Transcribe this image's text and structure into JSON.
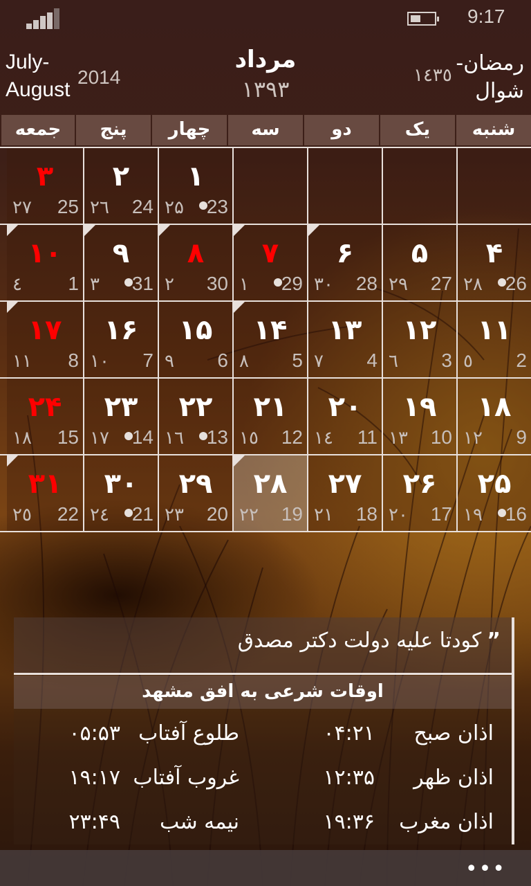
{
  "status_bar": {
    "signal_icon": "signal-strength-icon",
    "battery_icon": "battery-icon",
    "battery_level_percent": 35,
    "time": "9:17"
  },
  "header": {
    "gregorian_month": "July-\nAugust",
    "gregorian_month_line1": "July-",
    "gregorian_month_line2": "August",
    "gregorian_year": "2014",
    "persian_month": "مرداد",
    "persian_year": "۱۳۹۳",
    "hijri_month_line1": "رمضان-",
    "hijri_month_line2": "شوال",
    "hijri_year": "۱٤۳٥"
  },
  "weekdays": [
    "شنبه",
    "یک",
    "دو",
    "سه",
    "چهار",
    "پنج",
    "جمعه"
  ],
  "calendar": {
    "colors": {
      "holiday": "#ff0000",
      "normal": "#ffffff",
      "secondary": "#c8c0bc"
    },
    "rows": [
      [
        {
          "empty": true
        },
        {
          "empty": true
        },
        {
          "empty": true
        },
        {
          "empty": true
        },
        {
          "persian": "۱",
          "greg": "23",
          "hijri": "۲۵",
          "dot": true
        },
        {
          "persian": "۲",
          "greg": "24",
          "hijri": "۲٦"
        },
        {
          "persian": "۳",
          "greg": "25",
          "hijri": "۲۷",
          "holiday": true
        }
      ],
      [
        {
          "persian": "۴",
          "greg": "26",
          "hijri": "۲۸",
          "dot": true
        },
        {
          "persian": "۵",
          "greg": "27",
          "hijri": "۲۹"
        },
        {
          "persian": "۶",
          "greg": "28",
          "hijri": "۳۰",
          "corner": true
        },
        {
          "persian": "۷",
          "greg": "29",
          "hijri": "۱",
          "dot": true,
          "holiday": true,
          "corner": true
        },
        {
          "persian": "۸",
          "greg": "30",
          "hijri": "۲",
          "holiday": true,
          "corner": true
        },
        {
          "persian": "۹",
          "greg": "31",
          "hijri": "۳",
          "dot": true,
          "corner": true
        },
        {
          "persian": "۱۰",
          "greg": "1",
          "hijri": "٤",
          "holiday": true,
          "corner": true
        }
      ],
      [
        {
          "persian": "۱۱",
          "greg": "2",
          "hijri": "٥"
        },
        {
          "persian": "۱۲",
          "greg": "3",
          "hijri": "٦"
        },
        {
          "persian": "۱۳",
          "greg": "4",
          "hijri": "۷"
        },
        {
          "persian": "۱۴",
          "greg": "5",
          "hijri": "۸",
          "corner": true
        },
        {
          "persian": "۱۵",
          "greg": "6",
          "hijri": "۹"
        },
        {
          "persian": "۱۶",
          "greg": "7",
          "hijri": "۱۰"
        },
        {
          "persian": "۱۷",
          "greg": "8",
          "hijri": "۱۱",
          "holiday": true,
          "corner": true
        }
      ],
      [
        {
          "persian": "۱۸",
          "greg": "9",
          "hijri": "۱۲"
        },
        {
          "persian": "۱۹",
          "greg": "10",
          "hijri": "۱۳"
        },
        {
          "persian": "۲۰",
          "greg": "11",
          "hijri": "۱٤"
        },
        {
          "persian": "۲۱",
          "greg": "12",
          "hijri": "۱٥"
        },
        {
          "persian": "۲۲",
          "greg": "13",
          "hijri": "۱٦",
          "dot": true
        },
        {
          "persian": "۲۳",
          "greg": "14",
          "hijri": "۱۷",
          "dot": true
        },
        {
          "persian": "۲۴",
          "greg": "15",
          "hijri": "۱۸",
          "holiday": true
        }
      ],
      [
        {
          "persian": "۲۵",
          "greg": "16",
          "hijri": "۱۹",
          "dot": true
        },
        {
          "persian": "۲۶",
          "greg": "17",
          "hijri": "۲۰"
        },
        {
          "persian": "۲۷",
          "greg": "18",
          "hijri": "۲۱"
        },
        {
          "persian": "۲۸",
          "greg": "19",
          "hijri": "۲۲",
          "today": true,
          "corner": true
        },
        {
          "persian": "۲۹",
          "greg": "20",
          "hijri": "۲۳"
        },
        {
          "persian": "۳۰",
          "greg": "21",
          "hijri": "۲٤",
          "dot": true
        },
        {
          "persian": "۳۱",
          "greg": "22",
          "hijri": "۲٥",
          "holiday": true,
          "corner": true
        }
      ]
    ]
  },
  "event": {
    "quote_mark": "”",
    "text": "کودتا علیه دولت دکتر مصدق"
  },
  "oqat": {
    "title": "اوقات شرعی به افق مشهد",
    "right_column": [
      {
        "name": "اذان صبح",
        "time": "۰۴:۲۱"
      },
      {
        "name": "اذان ظهر",
        "time": "۱۲:۳۵"
      },
      {
        "name": "اذان مغرب",
        "time": "۱۹:۳۶"
      }
    ],
    "left_column": [
      {
        "name": "طلوع آفتاب",
        "time": "۰۵:۵۳"
      },
      {
        "name": "غروب آفتاب",
        "time": "۱۹:۱۷"
      },
      {
        "name": "نیمه شب",
        "time": "۲۳:۴۹"
      }
    ]
  },
  "app_bar": {
    "more_label": "•••",
    "more_icon": "more-ellipsis-icon"
  }
}
